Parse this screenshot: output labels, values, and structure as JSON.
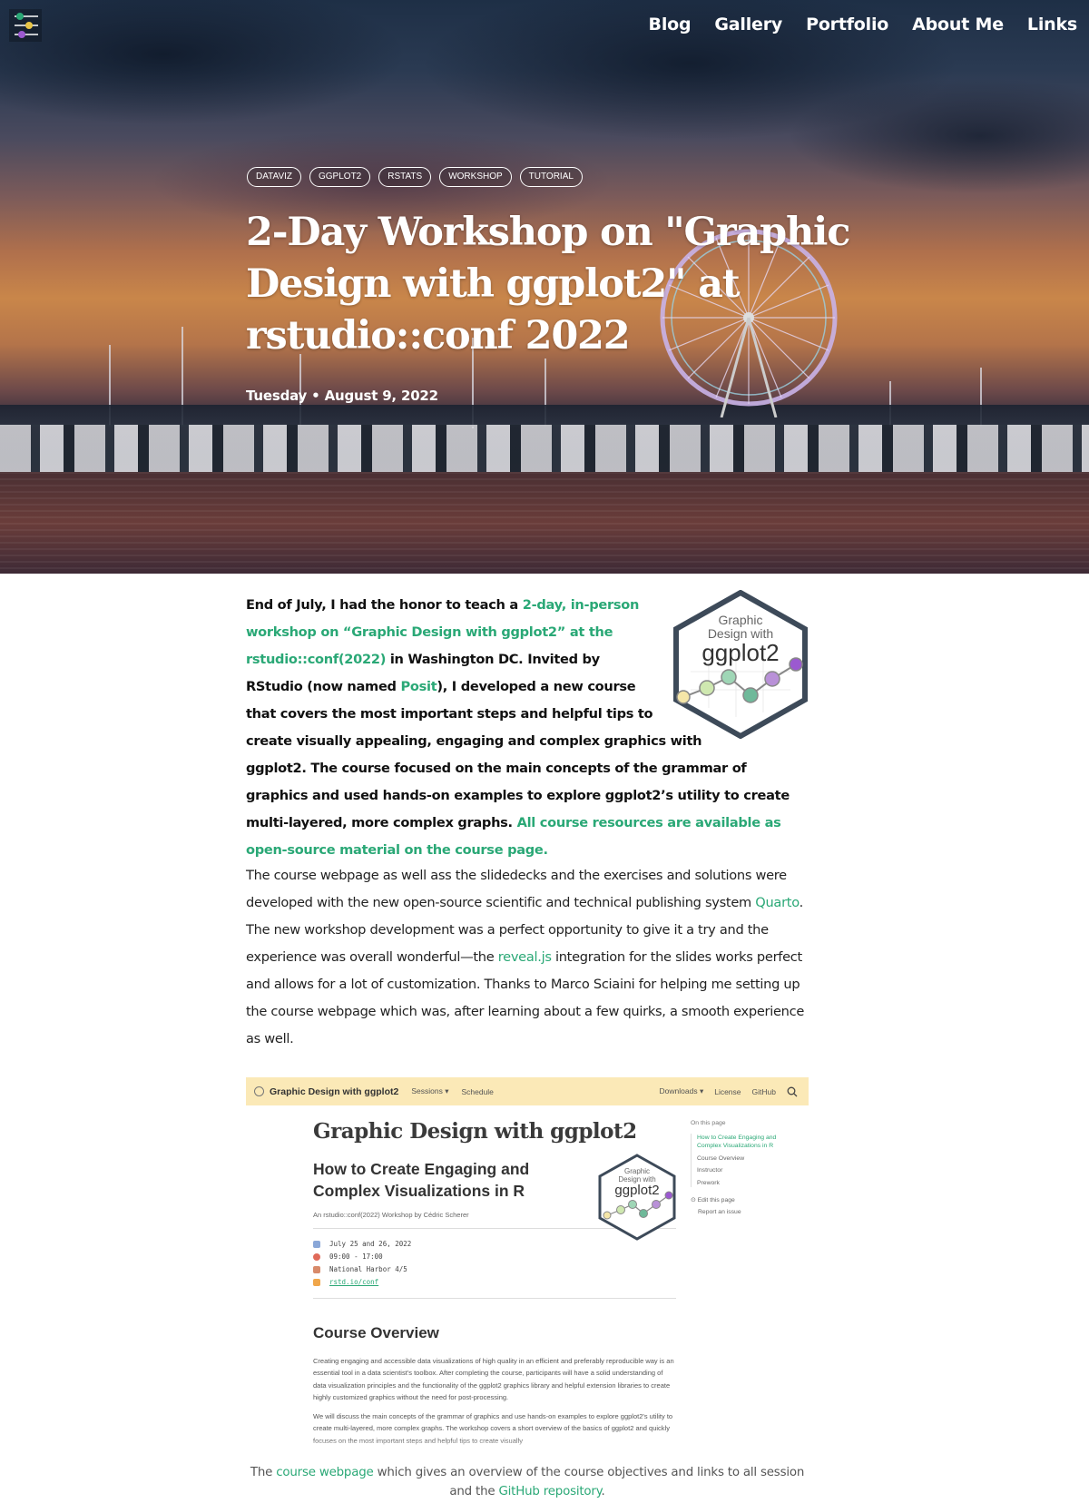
{
  "nav": {
    "items": [
      "Blog",
      "Gallery",
      "Portfolio",
      "About Me",
      "Links"
    ]
  },
  "hero": {
    "tags": [
      "DATAVIZ",
      "GGPLOT2",
      "RSTATS",
      "WORKSHOP",
      "TUTORIAL"
    ],
    "title": "2-Day Workshop on \"Graphic Design with ggplot2\" at rstudio::conf 2022",
    "date": "Tuesday • August 9, 2022"
  },
  "intro": {
    "t1": "End of July, I had the honor to teach a ",
    "link1": "2-day, in-person workshop on “Graphic Design with ggplot2” at the rstudio::conf(2022)",
    "t2": " in Washington DC. Invited by RStudio (now named ",
    "link2": "Posit",
    "t3": "), I developed a new course that covers the most important steps and helpful tips to create visually appealing, engaging and complex graphics with ggplot2. The course focused on the main concepts of the grammar of graphics and used hands-on examples to explore ggplot2’s utility to create multi-layered, more complex graphs. ",
    "link3": "All course resources are available as open-source material on the course page."
  },
  "hex_logo": {
    "line1": "Graphic",
    "line2": "Design with",
    "line3": "ggplot2"
  },
  "body": {
    "t1": "The course webpage as well ass the slidedecks and the exercises and solutions were developed with the new open-source scientific and technical publishing system ",
    "link1": "Quarto",
    "t2": ". The new workshop development was a perfect opportunity to give it a try and the experience was overall wonderful—the ",
    "link2": "reveal.js",
    "t3": " integration for the slides works perfect and allows for a lot of customization. Thanks to Marco Sciaini for helping me setting up the course webpage which was, after learning about a few quirks, a smooth experience as well."
  },
  "screenshot": {
    "brand": "Graphic Design with ggplot2",
    "menu_sessions": "Sessions ▾",
    "menu_schedule": "Schedule",
    "menu_downloads": "Downloads ▾",
    "menu_license": "License",
    "menu_github": "GitHub",
    "h1": "Graphic Design with ggplot2",
    "h2": "How to Create Engaging and Complex Visualizations in R",
    "byline": "An rstudio::conf(2022) Workshop by Cédric Scherer",
    "info": [
      "July 25 and 26, 2022",
      "09:00 - 17:00",
      "National Harbor 4/5",
      "rstd.io/conf"
    ],
    "h3": "Course Overview",
    "para1": "Creating engaging and accessible data visualizations of high quality in an efficient and preferably reproducible way is an essential tool in a data scientist's toolbox. After completing the course, participants will have a solid understanding of data visualization principles and the functionality of the ggplot2 graphics library and helpful extension libraries to create highly customized graphics without the need for post-processing.",
    "para2": "We will discuss the main concepts of the grammar of graphics and use hands-on examples to explore ggplot2's utility to create multi-layered, more complex graphs. The workshop covers a short overview of the basics of ggplot2 and quickly focuses on the most important steps and helpful tips to create visually",
    "toc_title": "On this page",
    "toc_items": [
      "How to Create Engaging and Complex Visualizations in R",
      "Course Overview",
      "Instructor",
      "Prework"
    ],
    "toc_edit": "Edit this page",
    "toc_issue": "Report an issue",
    "hex_line1": "Graphic",
    "hex_line2": "Design with",
    "hex_line3": "ggplot2"
  },
  "caption": {
    "t1": "The ",
    "link1": "course webpage",
    "t2": " which gives an overview of the course objectives and links to all session and the ",
    "link2": "GitHub repository",
    "t3": "."
  },
  "colors": {
    "accent_green": "#2aa876",
    "nav_bar_yellow": "#fbe9b7",
    "hex_border": "#3d4a59"
  }
}
